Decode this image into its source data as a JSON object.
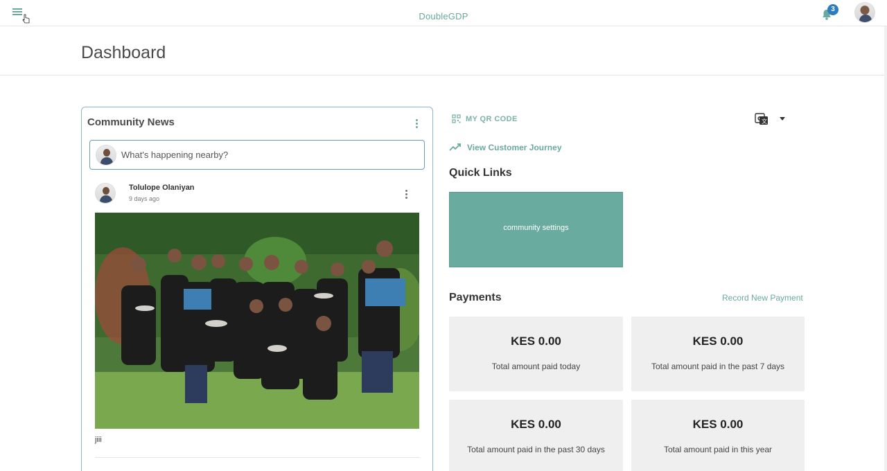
{
  "appbar": {
    "brand": "DoubleGDP",
    "notification_count": "3",
    "icons": {
      "menu": "menu-icon",
      "notifications": "bell-icon",
      "avatar": "user-avatar"
    }
  },
  "page": {
    "title": "Dashboard"
  },
  "community_news": {
    "title": "Community News",
    "composer_placeholder": "What's happening nearby?",
    "post": {
      "author": "Tolulope Olaniyan",
      "time": "9 days ago",
      "caption": "jiii"
    }
  },
  "actions": {
    "qr_label": "MY QR CODE",
    "journey_label": "View Customer Journey"
  },
  "quick_links": {
    "title": "Quick Links",
    "items": [
      {
        "label": "community settings"
      }
    ]
  },
  "payments": {
    "title": "Payments",
    "record_label": "Record New Payment",
    "cards": [
      {
        "amount": "KES 0.00",
        "label": "Total amount paid today"
      },
      {
        "amount": "KES 0.00",
        "label": "Total amount paid in the past 7 days"
      },
      {
        "amount": "KES 0.00",
        "label": "Total amount paid in the past 30 days"
      },
      {
        "amount": "KES 0.00",
        "label": "Total amount paid in this year"
      }
    ]
  },
  "colors": {
    "accent": "#69ab9f",
    "badge": "#2b7dbf",
    "card_border": "#8fb6c9",
    "payment_card_bg": "#efefef"
  }
}
